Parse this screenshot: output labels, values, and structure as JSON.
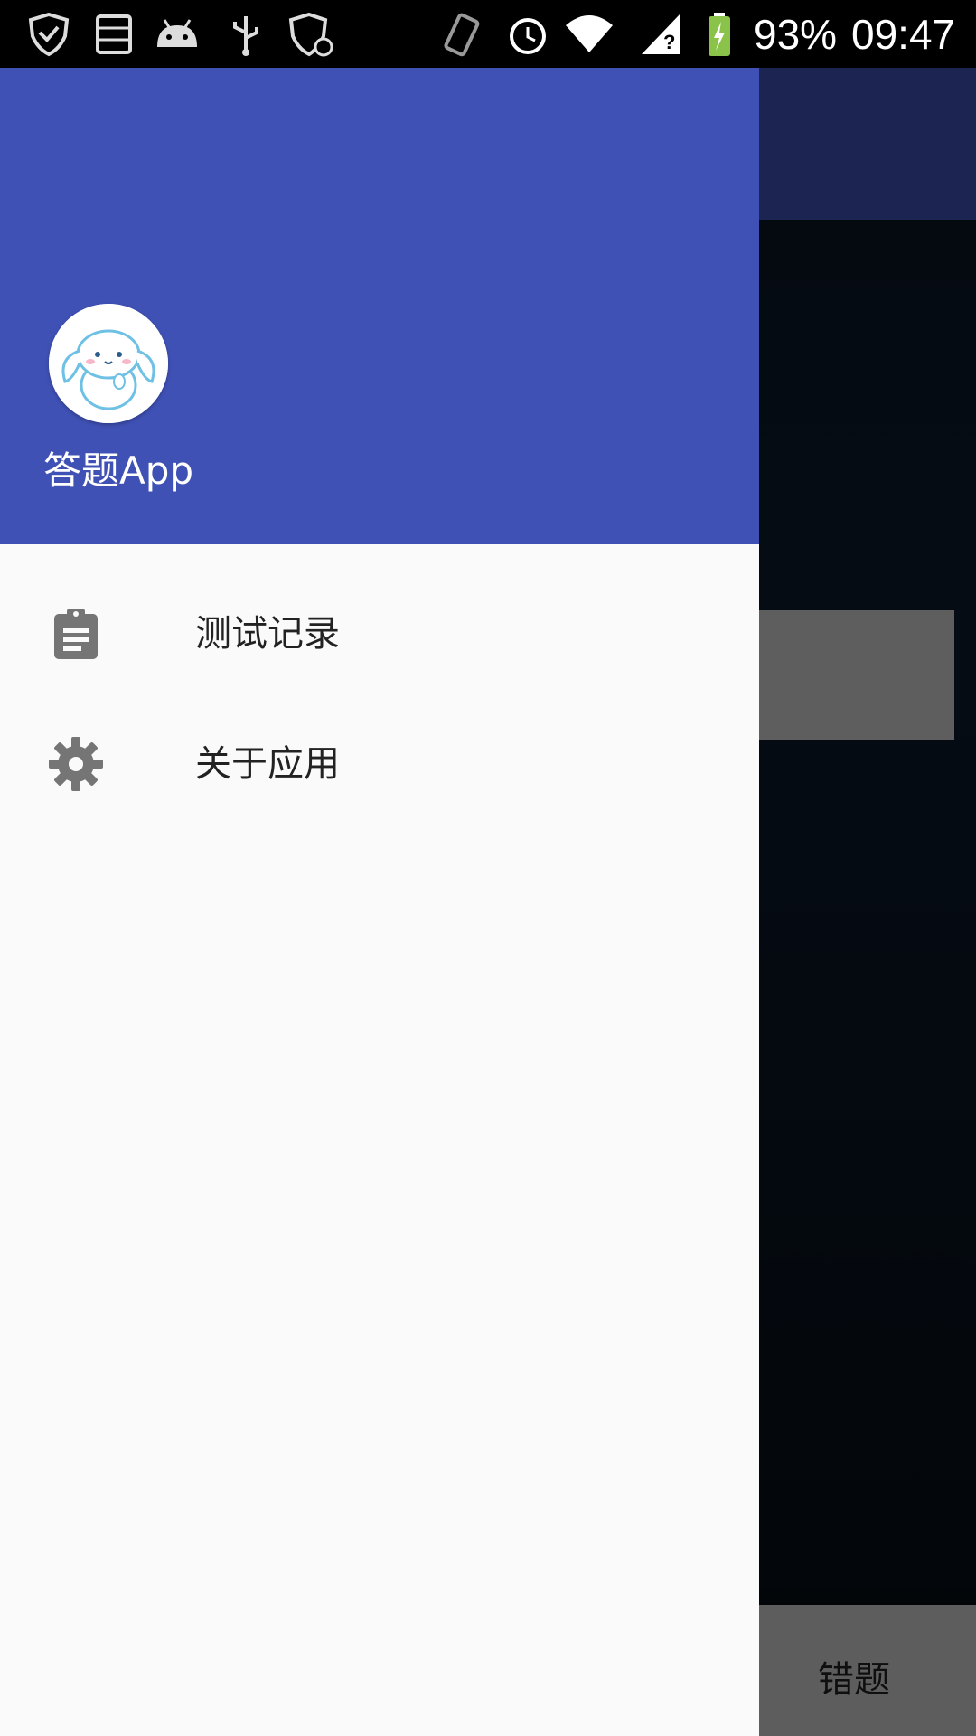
{
  "status_bar": {
    "battery_percent": "93%",
    "time": "09:47",
    "icons": [
      "shield-check-icon",
      "sd-card-icon",
      "android-icon",
      "usb-icon",
      "shield-sync-icon",
      "vibrate-icon",
      "alarm-icon",
      "wifi-icon",
      "signal-unknown-icon",
      "battery-charging-icon"
    ]
  },
  "drawer": {
    "header": {
      "app_name": "答题App",
      "avatar": "cinnamoroll-avatar"
    },
    "items": [
      {
        "label": "测试记录",
        "icon": "clipboard-icon"
      },
      {
        "label": "关于应用",
        "icon": "gear-icon"
      }
    ]
  },
  "background": {
    "bottom_button_label": "错题"
  },
  "colors": {
    "primary": "#3f51b5",
    "drawer_bg": "#fafafa",
    "icon_gray": "#757575",
    "text_primary": "#222222"
  }
}
